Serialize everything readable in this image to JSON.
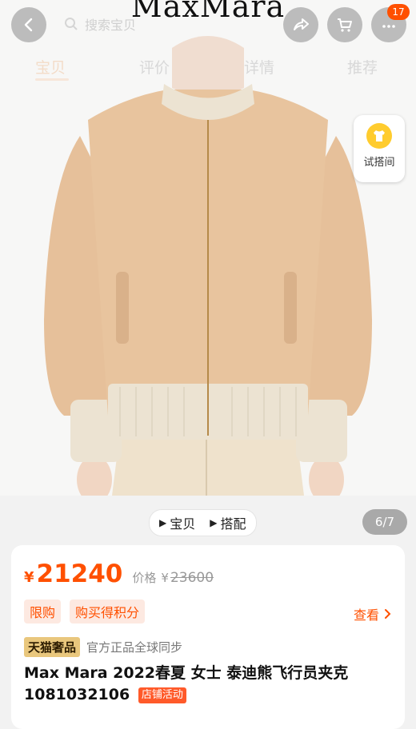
{
  "hero": {
    "brand": "MaxMara",
    "search_placeholder": "搜索宝贝",
    "cart_badge": "17",
    "tabs": [
      {
        "label": "宝贝",
        "active": true
      },
      {
        "label": "评价",
        "active": false
      },
      {
        "label": "详情",
        "active": false
      },
      {
        "label": "推荐",
        "active": false
      }
    ],
    "tryon_label": "试搭间"
  },
  "gallery": {
    "buttons": [
      {
        "label": "宝贝"
      },
      {
        "label": "搭配"
      }
    ],
    "page_indicator": "6/7"
  },
  "product": {
    "price_symbol": "¥",
    "price": "21240",
    "orig_label": "价格",
    "orig_symbol": "¥",
    "orig_price": "23600",
    "tags": [
      "限购",
      "购买得积分"
    ],
    "see_more": "查看",
    "lux_badge": "天猫奢品",
    "lux_text": "官方正品全球同步",
    "title": "Max Mara 2022春夏 女士 泰迪熊飞行员夹克 1081032106",
    "store_activity": "店铺活动"
  },
  "colors": {
    "accent": "#ff5000",
    "jacket": "#e7c39c",
    "rib": "#ece4d4"
  }
}
